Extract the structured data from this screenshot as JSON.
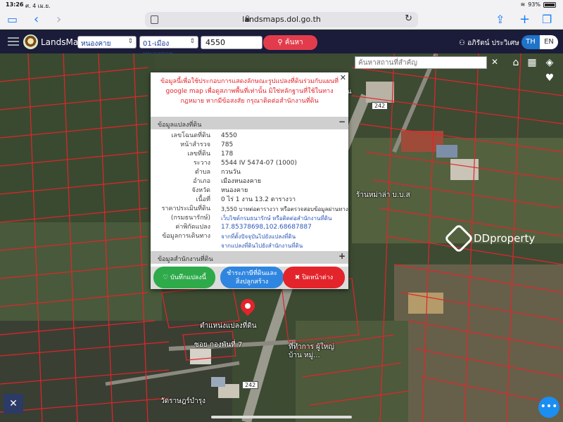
{
  "status": {
    "time": "13:26",
    "date": "ศ. 4 เม.ย.",
    "battery": "93%"
  },
  "browser": {
    "url": "landsmaps.dol.go.th"
  },
  "header": {
    "brand": "LandsMaps",
    "province": "หนองคาย",
    "district": "01-เมืองหนองคาย",
    "parcel_query": "4550",
    "search_label": "ค้นหา",
    "user": "อภิรัตน์ ประวิเศษ",
    "lang_th": "TH",
    "lang_en": "EN"
  },
  "map": {
    "search_placeholder": "ค้นหาสถานที่สำคัญ",
    "pin_label": "ตำแหน่งแปลงที่ดิน",
    "labels": {
      "shop": "ร้านหม่าล่า บ.บ.ส",
      "soi": "ซอย กองพันที่ 7",
      "office": "ที่ทำการ ผู้ใหญ่บ้าน หมู่...",
      "temple": "วัดราษฎร์บำรุง",
      "top_right": "รวรณ"
    },
    "road_badges": [
      "242",
      "242"
    ],
    "colors": {
      "parcel_line": "#e3242b",
      "pin": "#e3242b",
      "fab": "#1b8ef2"
    }
  },
  "watermark": {
    "text": "DDproperty"
  },
  "popup": {
    "warning": "ข้อมูลนี้เพื่อใช้ประกอบการแสดงลักษณะรูปแปลงที่ดินร่วมกับแผนที่ google map เพื่อดูสภาพพื้นที่เท่านั้น มิใช่หลักฐานที่ใช้ในทางกฎหมาย หากมีข้อสงสัย กรุณาติดต่อสำนักงานที่ดิน",
    "section_parcel": "ข้อมูลแปลงที่ดิน",
    "section_office": "ข้อมูลสำนักงานที่ดิน",
    "rows": [
      {
        "k": "เลขโฉนดที่ดิน",
        "v": "4550"
      },
      {
        "k": "หน้าสำรวจ",
        "v": "785"
      },
      {
        "k": "เลขที่ดิน",
        "v": "178"
      },
      {
        "k": "ระวาง",
        "v": "5544 IV 5474-07 (1000)"
      },
      {
        "k": "ตำบล",
        "v": "กวนวัน"
      },
      {
        "k": "อำเภอ",
        "v": "เมืองหนองคาย"
      },
      {
        "k": "จังหวัด",
        "v": "หนองคาย"
      },
      {
        "k": "เนื้อที่",
        "v": "0 ไร่ 1 งาน 13.2 ตารางวา"
      },
      {
        "k": "ราคาประเมินที่ดิน",
        "v": "3,550 บาทต่อตารางวา หรือตรวจสอบข้อมูลผ่านทาง"
      },
      {
        "k": "(กรมธนารักษ์)",
        "v": "เว็บไซต์กรมธนารักษ์ หรือติดต่อสำนักงานที่ดิน"
      },
      {
        "k": "ค่าพิกัดแปลง",
        "v": "17.85378698,102.68687887"
      },
      {
        "k": "ข้อมูลการเดินทาง",
        "v": "จากที่ตั้งปัจจุบันไปยังแปลงที่ดิน"
      },
      {
        "k": "",
        "v": "จากแปลงที่ดินไปยังสำนักงานที่ดิน"
      }
    ],
    "btn_save": "บันทึกแปลงนี้",
    "btn_tax": "ชำระภาษีที่ดินและสิ่งปลูกสร้าง",
    "btn_close": "ปิดหน้าต่าง"
  }
}
